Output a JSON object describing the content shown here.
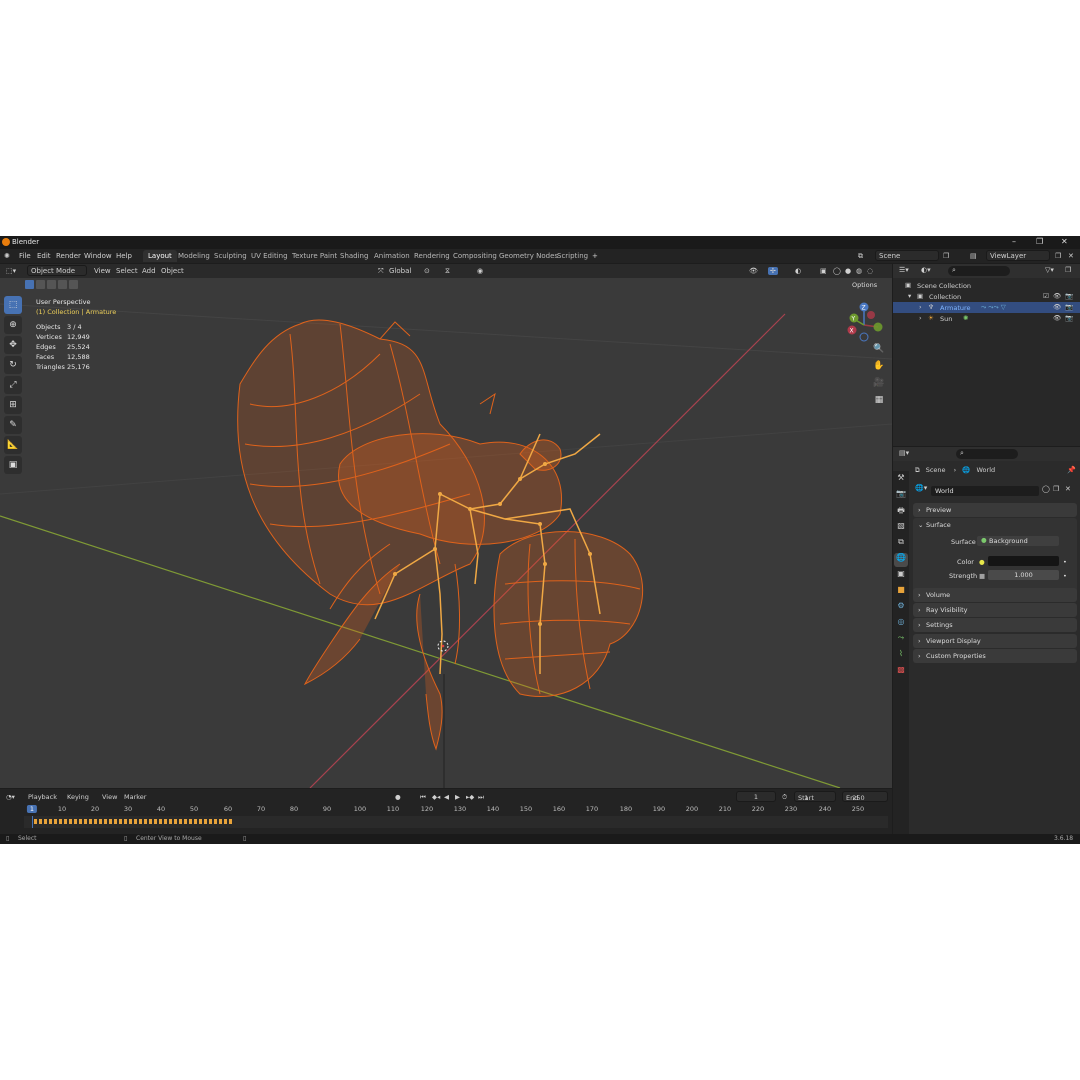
{
  "app": {
    "title": "Blender",
    "version": "3.6.18"
  },
  "menu": [
    "File",
    "Edit",
    "Render",
    "Window",
    "Help"
  ],
  "workspaces": [
    "Layout",
    "Modeling",
    "Sculpting",
    "UV Editing",
    "Texture Paint",
    "Shading",
    "Animation",
    "Rendering",
    "Compositing",
    "Geometry Nodes",
    "Scripting"
  ],
  "active_workspace": "Layout",
  "scene_field": "Scene",
  "viewlayer_field": "ViewLayer",
  "viewport": {
    "mode": "Object Mode",
    "menus": [
      "View",
      "Select",
      "Add",
      "Object"
    ],
    "orientation": "Global",
    "options": "Options",
    "perspective": "User Perspective",
    "collection_info": "(1) Collection | Armature",
    "stats": [
      {
        "label": "Objects",
        "value": "3 / 4"
      },
      {
        "label": "Vertices",
        "value": "12,949"
      },
      {
        "label": "Edges",
        "value": "25,524"
      },
      {
        "label": "Faces",
        "value": "12,588"
      },
      {
        "label": "Triangles",
        "value": "25,176"
      }
    ],
    "gizmo": {
      "x": "X",
      "y": "Y",
      "z": "Z"
    }
  },
  "timeline": {
    "menus": [
      "Playback",
      "Keying",
      "View",
      "Marker"
    ],
    "current_frame": "1",
    "start_label": "Start",
    "start": "1",
    "end_label": "End",
    "end": "250",
    "ticks": [
      "1",
      "10",
      "20",
      "30",
      "40",
      "50",
      "60",
      "70",
      "80",
      "90",
      "100",
      "110",
      "120",
      "130",
      "140",
      "150",
      "160",
      "170",
      "180",
      "190",
      "200",
      "210",
      "220",
      "230",
      "240",
      "250"
    ]
  },
  "status": {
    "select": "Select",
    "center": "Center View to Mouse"
  },
  "outliner": {
    "items": [
      {
        "label": "Scene Collection"
      },
      {
        "label": "Collection"
      },
      {
        "label": "Armature"
      },
      {
        "label": "Sun"
      }
    ]
  },
  "properties": {
    "breadcrumb_scene": "Scene",
    "breadcrumb_world": "World",
    "world_name": "World",
    "panels": {
      "preview": "Preview",
      "surface": "Surface",
      "volume": "Volume",
      "ray_visibility": "Ray Visibility",
      "settings": "Settings",
      "viewport_display": "Viewport Display",
      "custom_properties": "Custom Properties"
    },
    "surface_label": "Surface",
    "surface_value": "Background",
    "color_label": "Color",
    "strength_label": "Strength",
    "strength_value": "1.000"
  },
  "colors": {
    "accent": "#4772b3",
    "wire": "#e8651a",
    "bone": "#f0a844",
    "selected_row": "#334d80"
  }
}
